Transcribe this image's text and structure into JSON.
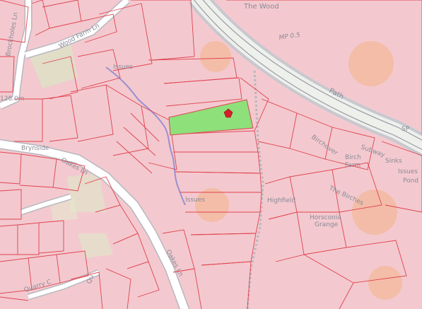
{
  "map": {
    "labels": {
      "wood": "The Wood",
      "mp": "MP 0.5",
      "path": "Path",
      "sp": "SP",
      "brockholes": "Brockholes Ln",
      "woodfarm": "Wood Farm Ln",
      "issues1": "Issues",
      "issues2": "Issues",
      "issues3": "Issues",
      "pond": "Pond",
      "brynside": "Brynside",
      "oakes1": "Oakes Ln",
      "oakes2": "Oakes Ln",
      "altitude": "128.0m",
      "birchover": "Birchover",
      "birchfarm1": "Birch",
      "birchfarm2": "Farm",
      "subway": "Subway",
      "sinks": "Sinks",
      "highfield": "Highfield",
      "thebirches": "The Birches",
      "horsconia1": "Horsconia",
      "horsconia2": "Grange",
      "quarry": "Quarry C",
      "quarry2": "Qu"
    },
    "colors": {
      "background": "#f3c9cf",
      "parcel_border": "#e0424f",
      "highlight": "#8de07a",
      "marker": "#d41f2b",
      "road": "#ffffff",
      "road_casing": "#b7b7bf",
      "stream": "#9a8fd1"
    },
    "marker_icon": "map-pin-icon"
  }
}
